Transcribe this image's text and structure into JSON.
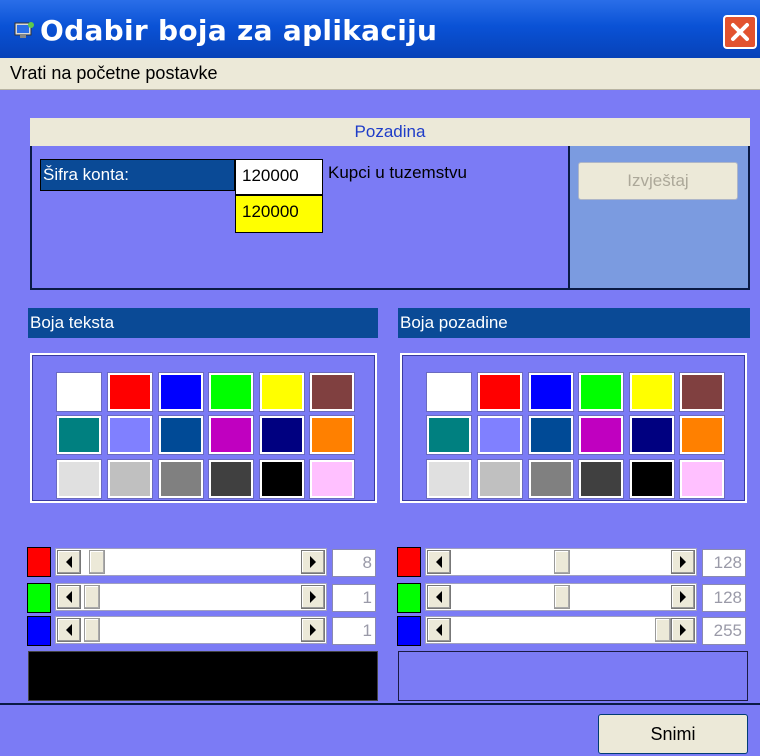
{
  "window": {
    "title": "Odabir boja za aplikaciju"
  },
  "menu": {
    "reset_label": "Vrati na početne postavke"
  },
  "pozadina_section": {
    "header": "Pozadina",
    "sifra_label": "Šifra konta:",
    "sifra_value": "120000",
    "sifra_preview": "120000",
    "account_name": "Kupci u tuzemstvu",
    "report_button": "Izvještaj"
  },
  "text_color_section": {
    "header": "Boja teksta"
  },
  "bg_color_section": {
    "header": "Boja pozadine"
  },
  "palette_colors": [
    [
      "#ffffff",
      "#ff0000",
      "#0000ff",
      "#00ff00",
      "#ffff00",
      "#804040"
    ],
    [
      "#008080",
      "#8080ff",
      "#004a96",
      "#c000c0",
      "#000080",
      "#ff8000"
    ],
    [
      "#e0e0e0",
      "#c0c0c0",
      "#808080",
      "#404040",
      "#000000",
      "#ffc0ff"
    ]
  ],
  "text_rgb": {
    "red": "8",
    "green": "1",
    "blue": "1",
    "red_fraction": 0.031,
    "green_fraction": 0.004,
    "blue_fraction": 0.004
  },
  "bg_rgb": {
    "red": "128",
    "green": "128",
    "blue": "255",
    "red_fraction": 0.502,
    "green_fraction": 0.502,
    "blue_fraction": 1.0
  },
  "indicator_colors": {
    "red": "#ff0000",
    "green": "#00ff00",
    "blue": "#0000ff"
  },
  "preview": {
    "text_color": "#000000",
    "bg_color": "#7b7bf5"
  },
  "footer": {
    "save_button": "Snimi"
  }
}
